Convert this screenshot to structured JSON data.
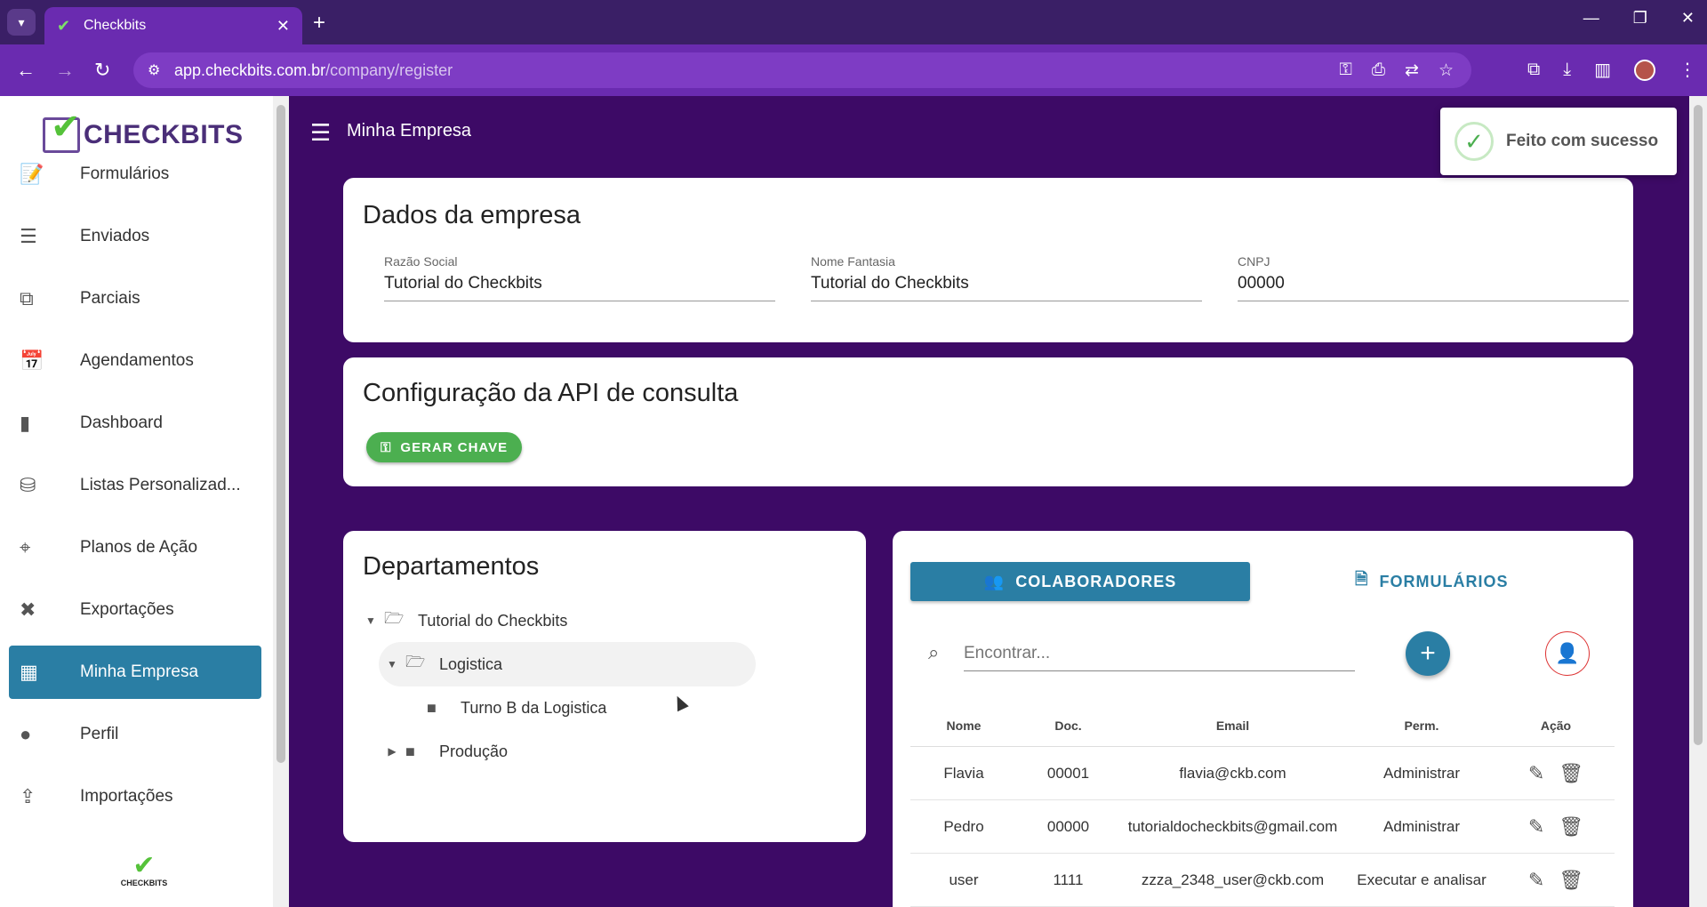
{
  "browser": {
    "tab_title": "Checkbits",
    "url_host": "app.checkbits.com.br",
    "url_path": "/company/register"
  },
  "sidebar": {
    "logo_text": "CHECKBITS",
    "footer_logo_text": "CHECKBITS",
    "items": [
      {
        "label": "Formulários",
        "icon": "form-icon"
      },
      {
        "label": "Enviados",
        "icon": "sent-icon"
      },
      {
        "label": "Parciais",
        "icon": "partial-icon"
      },
      {
        "label": "Agendamentos",
        "icon": "calendar-icon"
      },
      {
        "label": "Dashboard",
        "icon": "bar-chart-icon"
      },
      {
        "label": "Listas Personalizad...",
        "icon": "database-icon"
      },
      {
        "label": "Planos de Ação",
        "icon": "target-icon"
      },
      {
        "label": "Exportações",
        "icon": "excel-icon"
      },
      {
        "label": "Minha Empresa",
        "icon": "building-icon",
        "active": true
      },
      {
        "label": "Perfil",
        "icon": "person-icon"
      },
      {
        "label": "Importações",
        "icon": "import-icon"
      }
    ]
  },
  "header": {
    "title": "Minha Empresa"
  },
  "company": {
    "title": "Dados da empresa",
    "fields": [
      {
        "label": "Razão Social",
        "value": "Tutorial do Checkbits"
      },
      {
        "label": "Nome Fantasia",
        "value": "Tutorial do Checkbits"
      },
      {
        "label": "CNPJ",
        "value": "00000"
      }
    ]
  },
  "api": {
    "title": "Configuração da API de consulta",
    "button": "GERAR CHAVE"
  },
  "departments": {
    "title": "Departamentos",
    "nodes": [
      {
        "label": "Tutorial do Checkbits",
        "depth": 0,
        "caret": "down"
      },
      {
        "label": "Logistica",
        "depth": 1,
        "caret": "down",
        "selected": true
      },
      {
        "label": "Turno B da Logistica",
        "depth": 2,
        "caret": ""
      },
      {
        "label": "Produção",
        "depth": 1,
        "caret": "right"
      }
    ]
  },
  "members": {
    "tab_active": "COLABORADORES",
    "tab_other": "FORMULÁRIOS",
    "search_placeholder": "Encontrar...",
    "columns": {
      "nome": "Nome",
      "doc": "Doc.",
      "email": "Email",
      "perm": "Perm.",
      "acao": "Ação"
    },
    "rows": [
      {
        "nome": "Flavia",
        "doc": "00001",
        "email": "flavia@ckb.com",
        "perm": "Administrar"
      },
      {
        "nome": "Pedro",
        "doc": "00000",
        "email": "tutorialdocheckbits@gmail.com",
        "perm": "Administrar"
      },
      {
        "nome": "user",
        "doc": "1111",
        "email": "zzza_2348_user@ckb.com",
        "perm": "Executar e analisar"
      }
    ]
  },
  "toast": {
    "message": "Feito com sucesso"
  }
}
